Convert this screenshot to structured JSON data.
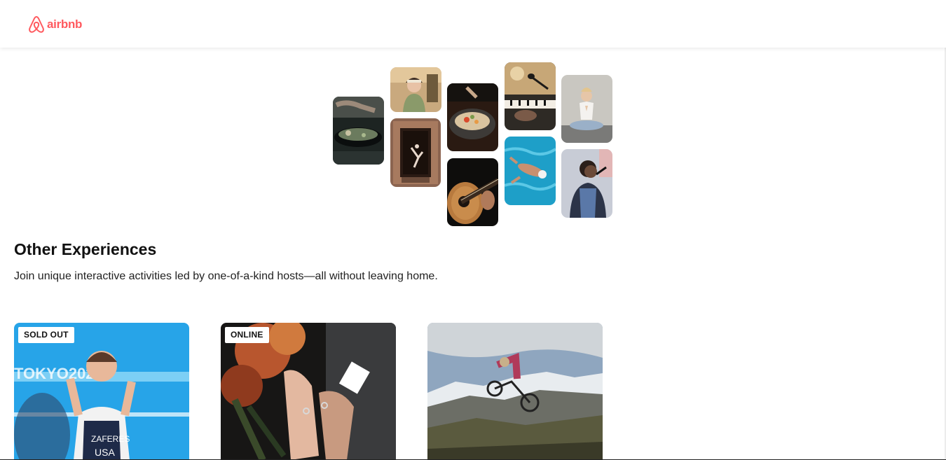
{
  "header": {
    "logo_text": "airbnb",
    "logo_icon": "airbnb-belo-icon",
    "brand_color": "#FF5A5F"
  },
  "collage": {
    "tiles": [
      {
        "id": "cooking-pan",
        "description_icon": "cooking-photo"
      },
      {
        "id": "woman-kitchen",
        "description_icon": "portrait-photo"
      },
      {
        "id": "dancer-doorway",
        "description_icon": "dance-photo"
      },
      {
        "id": "food-bowl",
        "description_icon": "food-photo"
      },
      {
        "id": "guitar",
        "description_icon": "guitar-photo"
      },
      {
        "id": "piano-microphone",
        "description_icon": "music-photo"
      },
      {
        "id": "swimmer",
        "description_icon": "swim-photo"
      },
      {
        "id": "yoga",
        "description_icon": "yoga-photo"
      },
      {
        "id": "singer",
        "description_icon": "singer-photo"
      }
    ]
  },
  "section": {
    "title": "Other Experiences",
    "subtitle": "Join unique interactive activities led by one-of-a-kind hosts—all without leaving home."
  },
  "cards": [
    {
      "badge": "SOLD OUT",
      "image": "athlete-photo"
    },
    {
      "badge": "ONLINE",
      "image": "wedding-hands-photo"
    },
    {
      "badge": "",
      "image": "mountain-bike-photo"
    }
  ],
  "colors": {
    "accent": "#FF5A5F",
    "text": "#222222",
    "badge_bg": "#FFFFFF"
  }
}
